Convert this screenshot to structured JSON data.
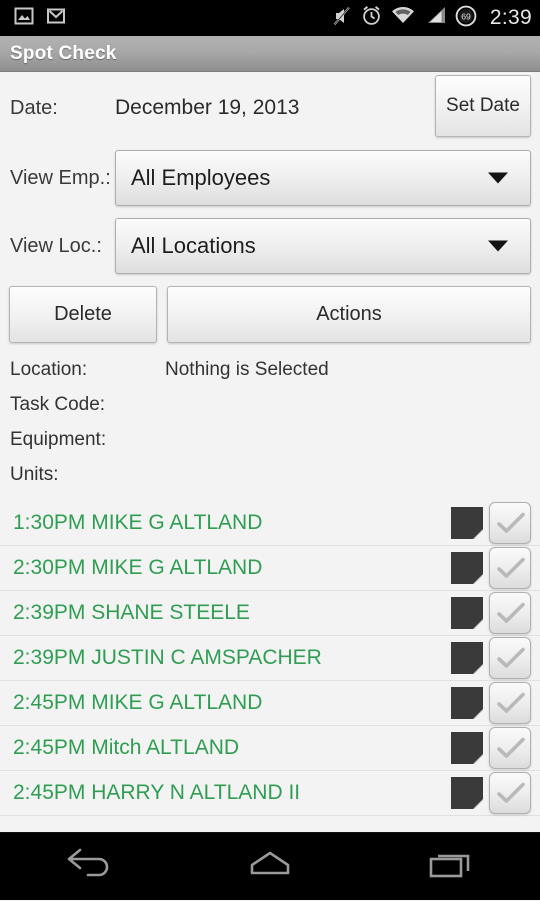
{
  "statusbar": {
    "left_icons": [
      "screenshot-image-icon",
      "gmail-icon"
    ],
    "right_icons": [
      "mute-icon",
      "alarm-clock-icon",
      "wifi-icon",
      "cellular-signal-icon"
    ],
    "battery_level": "69",
    "time": "2:39"
  },
  "titlebar": {
    "title": "Spot Check"
  },
  "form": {
    "date_label": "Date:",
    "date_value": "December 19, 2013",
    "set_date_button": "Set Date",
    "view_emp_label": "View Emp.:",
    "view_emp_value": "All Employees",
    "view_loc_label": "View Loc.:",
    "view_loc_value": "All Locations"
  },
  "actions": {
    "delete_label": "Delete",
    "actions_label": "Actions"
  },
  "info": [
    {
      "key": "Location:",
      "value": "Nothing is Selected"
    },
    {
      "key": "Task Code:",
      "value": ""
    },
    {
      "key": "Equipment:",
      "value": ""
    },
    {
      "key": "Units:",
      "value": ""
    }
  ],
  "list": {
    "rows": [
      {
        "label": "1:30PM MIKE G ALTLAND"
      },
      {
        "label": "2:30PM MIKE G ALTLAND"
      },
      {
        "label": "2:39PM SHANE STEELE"
      },
      {
        "label": "2:39PM JUSTIN C AMSPACHER"
      },
      {
        "label": "2:45PM MIKE G ALTLAND"
      },
      {
        "label": "2:45PM Mitch ALTLAND"
      },
      {
        "label": "2:45PM HARRY N ALTLAND II"
      }
    ]
  },
  "navbar": {
    "back_label": "Back",
    "home_label": "Home",
    "recents_label": "Recent apps"
  },
  "colors": {
    "row_text_green": "#2f9e52",
    "title_bar_gray": "#a8a8a8",
    "background": "#f3f3f3",
    "note_icon_dark": "#3a3a3a"
  }
}
